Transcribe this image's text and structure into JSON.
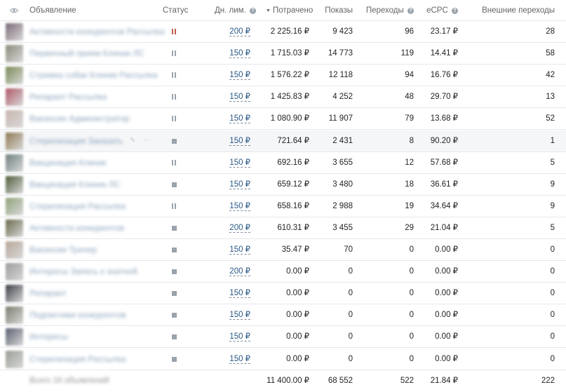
{
  "header": {
    "ad": "Объявление",
    "status": "Статус",
    "daily_limit": "Дн. лим.",
    "spent": "Потрачено",
    "impressions": "Показы",
    "clicks": "Переходы",
    "ecpc": "eCPC",
    "external_clicks": "Внешние переходы"
  },
  "rows": [
    {
      "name": "Активности конкурентов Рассылка",
      "status": "pause-red",
      "limit": "200 ₽",
      "spent": "2 225.16 ₽",
      "impressions": "9 423",
      "clicks": "96",
      "ecpc": "23.17 ₽",
      "external": "28",
      "thumb": "#7d6b78"
    },
    {
      "name": "Первичный прием Клиник ЛС",
      "status": "pause",
      "limit": "150 ₽",
      "spent": "1 715.03 ₽",
      "impressions": "14 773",
      "clicks": "119",
      "ecpc": "14.41 ₽",
      "external": "58",
      "thumb": "#8c8a7a"
    },
    {
      "name": "Стрижка собак Клиник Рассылка",
      "status": "pause",
      "limit": "150 ₽",
      "spent": "1 576.22 ₽",
      "impressions": "12 118",
      "clicks": "94",
      "ecpc": "16.76 ₽",
      "external": "42",
      "thumb": "#7a8a55"
    },
    {
      "name": "Репарант Рассылка",
      "status": "pause",
      "limit": "150 ₽",
      "spent": "1 425.83 ₽",
      "impressions": "4 252",
      "clicks": "48",
      "ecpc": "29.70 ₽",
      "external": "13",
      "thumb": "#b05868"
    },
    {
      "name": "Вакансии Администратор",
      "status": "pause",
      "limit": "150 ₽",
      "spent": "1 080.90 ₽",
      "impressions": "11 907",
      "clicks": "79",
      "ecpc": "13.68 ₽",
      "external": "52",
      "thumb": "#c9b6ae"
    },
    {
      "name": "Стерилизация Заказать",
      "status": "stop",
      "limit": "150 ₽",
      "spent": "721.64 ₽",
      "impressions": "2 431",
      "clicks": "8",
      "ecpc": "90.20 ₽",
      "external": "1",
      "thumb": "#8f7a52",
      "highlight": true
    },
    {
      "name": "Вакцинация Клиник",
      "status": "pause",
      "limit": "150 ₽",
      "spent": "692.16 ₽",
      "impressions": "3 655",
      "clicks": "12",
      "ecpc": "57.68 ₽",
      "external": "5",
      "thumb": "#6f8080"
    },
    {
      "name": "Вакцинация Клиник ЛС",
      "status": "stop",
      "limit": "150 ₽",
      "spent": "659.12 ₽",
      "impressions": "3 480",
      "clicks": "18",
      "ecpc": "36.61 ₽",
      "external": "9",
      "thumb": "#4f5e3c"
    },
    {
      "name": "Стерилизация Рассылка",
      "status": "pause",
      "limit": "150 ₽",
      "spent": "658.16 ₽",
      "impressions": "2 988",
      "clicks": "19",
      "ecpc": "34.64 ₽",
      "external": "9",
      "thumb": "#8fa27a"
    },
    {
      "name": "Активности конкурентов",
      "status": "stop",
      "limit": "200 ₽",
      "spent": "610.31 ₽",
      "impressions": "3 455",
      "clicks": "29",
      "ecpc": "21.04 ₽",
      "external": "5",
      "thumb": "#6b6a4a"
    },
    {
      "name": "Вакансии Тренер",
      "status": "stop",
      "limit": "150 ₽",
      "spent": "35.47 ₽",
      "impressions": "70",
      "clicks": "0",
      "ecpc": "0.00 ₽",
      "external": "0",
      "thumb": "#b7a79a"
    },
    {
      "name": "Интересы Запись к знатной",
      "status": "stop",
      "limit": "200 ₽",
      "spent": "0.00 ₽",
      "impressions": "0",
      "clicks": "0",
      "ecpc": "0.00 ₽",
      "external": "0",
      "thumb": "#9c9c9c"
    },
    {
      "name": "Репарант",
      "status": "stop",
      "limit": "150 ₽",
      "spent": "0.00 ₽",
      "impressions": "0",
      "clicks": "0",
      "ecpc": "0.00 ₽",
      "external": "0",
      "thumb": "#3c3f48"
    },
    {
      "name": "Подписчики конкурентов",
      "status": "stop",
      "limit": "150 ₽",
      "spent": "0.00 ₽",
      "impressions": "0",
      "clicks": "0",
      "ecpc": "0.00 ₽",
      "external": "0",
      "thumb": "#7b7d6e"
    },
    {
      "name": "Интересы",
      "status": "stop",
      "limit": "150 ₽",
      "spent": "0.00 ₽",
      "impressions": "0",
      "clicks": "0",
      "ecpc": "0.00 ₽",
      "external": "0",
      "thumb": "#5a6070"
    },
    {
      "name": "Стерилизация Рассылка",
      "status": "stop",
      "limit": "150 ₽",
      "spent": "0.00 ₽",
      "impressions": "0",
      "clicks": "0",
      "ecpc": "0.00 ₽",
      "external": "0",
      "thumb": "#9a9e94"
    }
  ],
  "totals": {
    "label": "Всего 16 объявлений",
    "spent": "11 400.00 ₽",
    "impressions": "68 552",
    "clicks": "522",
    "ecpc": "21.84 ₽",
    "external": "222"
  },
  "icons": {
    "visibility": "eye-icon",
    "info": "info-icon",
    "sort": "sort-down-icon"
  },
  "colors": {
    "link": "#2a5885",
    "pause_active": "#c05b4d",
    "muted": "#9aa2ab"
  }
}
